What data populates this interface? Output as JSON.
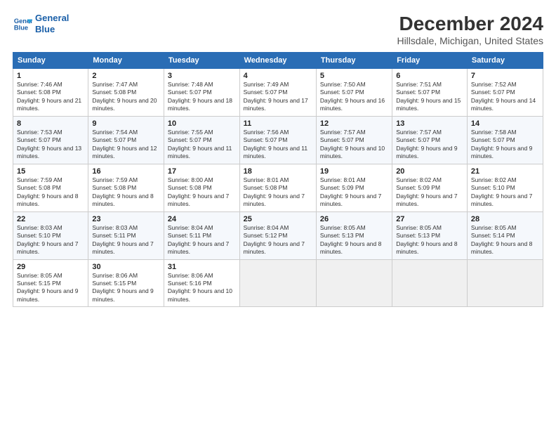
{
  "logo": {
    "line1": "General",
    "line2": "Blue"
  },
  "title": "December 2024",
  "subtitle": "Hillsdale, Michigan, United States",
  "days_of_week": [
    "Sunday",
    "Monday",
    "Tuesday",
    "Wednesday",
    "Thursday",
    "Friday",
    "Saturday"
  ],
  "weeks": [
    [
      {
        "day": "1",
        "sunrise": "7:46 AM",
        "sunset": "5:08 PM",
        "daylight": "9 hours and 21 minutes."
      },
      {
        "day": "2",
        "sunrise": "7:47 AM",
        "sunset": "5:08 PM",
        "daylight": "9 hours and 20 minutes."
      },
      {
        "day": "3",
        "sunrise": "7:48 AM",
        "sunset": "5:07 PM",
        "daylight": "9 hours and 18 minutes."
      },
      {
        "day": "4",
        "sunrise": "7:49 AM",
        "sunset": "5:07 PM",
        "daylight": "9 hours and 17 minutes."
      },
      {
        "day": "5",
        "sunrise": "7:50 AM",
        "sunset": "5:07 PM",
        "daylight": "9 hours and 16 minutes."
      },
      {
        "day": "6",
        "sunrise": "7:51 AM",
        "sunset": "5:07 PM",
        "daylight": "9 hours and 15 minutes."
      },
      {
        "day": "7",
        "sunrise": "7:52 AM",
        "sunset": "5:07 PM",
        "daylight": "9 hours and 14 minutes."
      }
    ],
    [
      {
        "day": "8",
        "sunrise": "7:53 AM",
        "sunset": "5:07 PM",
        "daylight": "9 hours and 13 minutes."
      },
      {
        "day": "9",
        "sunrise": "7:54 AM",
        "sunset": "5:07 PM",
        "daylight": "9 hours and 12 minutes."
      },
      {
        "day": "10",
        "sunrise": "7:55 AM",
        "sunset": "5:07 PM",
        "daylight": "9 hours and 11 minutes."
      },
      {
        "day": "11",
        "sunrise": "7:56 AM",
        "sunset": "5:07 PM",
        "daylight": "9 hours and 11 minutes."
      },
      {
        "day": "12",
        "sunrise": "7:57 AM",
        "sunset": "5:07 PM",
        "daylight": "9 hours and 10 minutes."
      },
      {
        "day": "13",
        "sunrise": "7:57 AM",
        "sunset": "5:07 PM",
        "daylight": "9 hours and 9 minutes."
      },
      {
        "day": "14",
        "sunrise": "7:58 AM",
        "sunset": "5:07 PM",
        "daylight": "9 hours and 9 minutes."
      }
    ],
    [
      {
        "day": "15",
        "sunrise": "7:59 AM",
        "sunset": "5:08 PM",
        "daylight": "9 hours and 8 minutes."
      },
      {
        "day": "16",
        "sunrise": "7:59 AM",
        "sunset": "5:08 PM",
        "daylight": "9 hours and 8 minutes."
      },
      {
        "day": "17",
        "sunrise": "8:00 AM",
        "sunset": "5:08 PM",
        "daylight": "9 hours and 7 minutes."
      },
      {
        "day": "18",
        "sunrise": "8:01 AM",
        "sunset": "5:08 PM",
        "daylight": "9 hours and 7 minutes."
      },
      {
        "day": "19",
        "sunrise": "8:01 AM",
        "sunset": "5:09 PM",
        "daylight": "9 hours and 7 minutes."
      },
      {
        "day": "20",
        "sunrise": "8:02 AM",
        "sunset": "5:09 PM",
        "daylight": "9 hours and 7 minutes."
      },
      {
        "day": "21",
        "sunrise": "8:02 AM",
        "sunset": "5:10 PM",
        "daylight": "9 hours and 7 minutes."
      }
    ],
    [
      {
        "day": "22",
        "sunrise": "8:03 AM",
        "sunset": "5:10 PM",
        "daylight": "9 hours and 7 minutes."
      },
      {
        "day": "23",
        "sunrise": "8:03 AM",
        "sunset": "5:11 PM",
        "daylight": "9 hours and 7 minutes."
      },
      {
        "day": "24",
        "sunrise": "8:04 AM",
        "sunset": "5:11 PM",
        "daylight": "9 hours and 7 minutes."
      },
      {
        "day": "25",
        "sunrise": "8:04 AM",
        "sunset": "5:12 PM",
        "daylight": "9 hours and 7 minutes."
      },
      {
        "day": "26",
        "sunrise": "8:05 AM",
        "sunset": "5:13 PM",
        "daylight": "9 hours and 8 minutes."
      },
      {
        "day": "27",
        "sunrise": "8:05 AM",
        "sunset": "5:13 PM",
        "daylight": "9 hours and 8 minutes."
      },
      {
        "day": "28",
        "sunrise": "8:05 AM",
        "sunset": "5:14 PM",
        "daylight": "9 hours and 8 minutes."
      }
    ],
    [
      {
        "day": "29",
        "sunrise": "8:05 AM",
        "sunset": "5:15 PM",
        "daylight": "9 hours and 9 minutes."
      },
      {
        "day": "30",
        "sunrise": "8:06 AM",
        "sunset": "5:15 PM",
        "daylight": "9 hours and 9 minutes."
      },
      {
        "day": "31",
        "sunrise": "8:06 AM",
        "sunset": "5:16 PM",
        "daylight": "9 hours and 10 minutes."
      },
      null,
      null,
      null,
      null
    ]
  ]
}
